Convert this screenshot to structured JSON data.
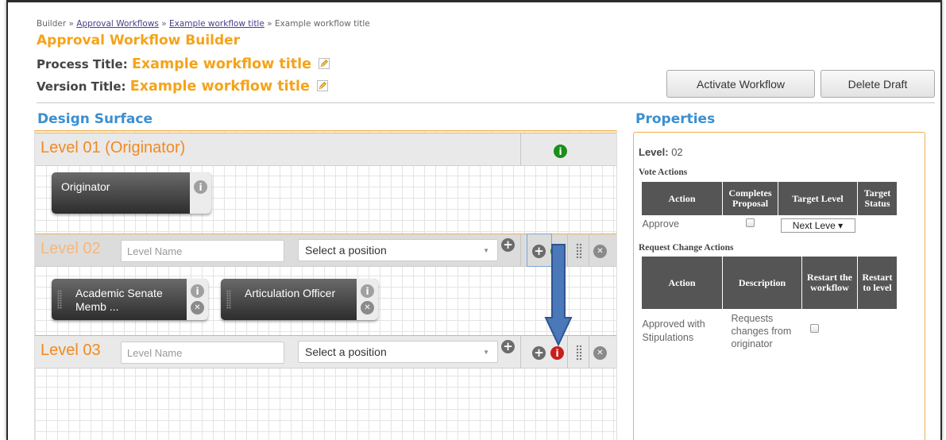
{
  "breadcrumb": {
    "root": "Builder",
    "sep": "»",
    "link1": "Approval Workflows",
    "link2": "Example workflow title",
    "current": "Example workflow title"
  },
  "app_title": "Approval Workflow Builder",
  "process": {
    "label": "Process Title:",
    "value": "Example workflow title"
  },
  "version": {
    "label": "Version Title:",
    "value": "Example workflow title"
  },
  "buttons": {
    "activate": "Activate Workflow",
    "delete": "Delete Draft"
  },
  "design": {
    "title": "Design Surface",
    "levels": [
      {
        "name": "Level 01 (Originator)",
        "cards": [
          "Originator"
        ]
      },
      {
        "name": "Level 02",
        "name_placeholder": "Level Name",
        "position": "Select a position",
        "cards": [
          "Academic Senate\nMemb ...",
          "Articulation Officer"
        ]
      },
      {
        "name": "Level 03",
        "name_placeholder": "Level Name",
        "position": "Select a position",
        "cards": []
      }
    ]
  },
  "properties": {
    "title": "Properties",
    "level_label": "Level:",
    "level_value": "02",
    "vote_actions": {
      "title": "Vote Actions",
      "headers": [
        "Action",
        "Completes Proposal",
        "Target Level",
        "Target Status"
      ],
      "rows": [
        {
          "action": "Approve",
          "completes": false,
          "target_level": "Next Leve"
        }
      ]
    },
    "request_change_actions": {
      "title": "Request Change Actions",
      "headers": [
        "Action",
        "Description",
        "Restart the workflow",
        "Restart to level"
      ],
      "rows": [
        {
          "action": "Approved with Stipulations",
          "description": "Requests changes from originator",
          "restart": false
        }
      ]
    }
  },
  "colors": {
    "accent_orange": "#f5a31a",
    "level_orange": "#f28a1e",
    "section_blue": "#3b8fd1",
    "info_green": "#1a8f1a",
    "info_red": "#c81e1e"
  },
  "icons": [
    "edit-pencil-icon",
    "add-icon",
    "info-icon",
    "drag-handle-icon",
    "remove-icon",
    "dropdown-caret-icon",
    "down-arrow-annotation"
  ]
}
